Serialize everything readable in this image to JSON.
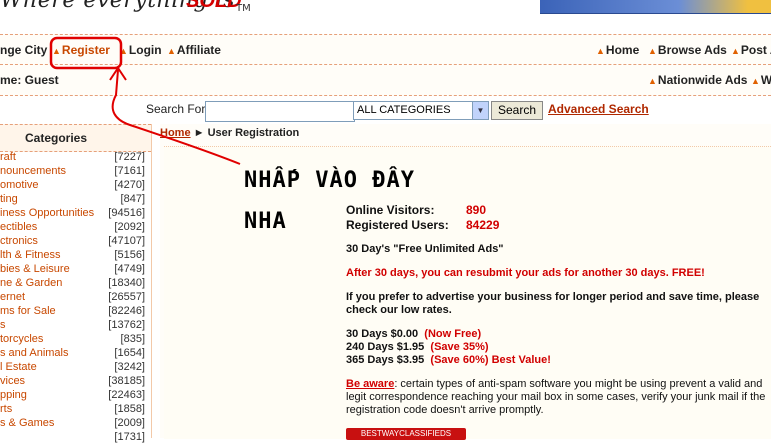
{
  "header": {
    "slogan": "Where everything is",
    "sold": "SOLD",
    "tm": "TM"
  },
  "nav": {
    "row1_left": [
      {
        "label": "nge City"
      },
      {
        "label": "Register"
      },
      {
        "label": "Login"
      },
      {
        "label": "Affiliate"
      }
    ],
    "row1_right": [
      {
        "label": "Home"
      },
      {
        "label": "Browse Ads"
      },
      {
        "label": "Post A"
      }
    ],
    "row2_left": "me: Guest",
    "row2_right": [
      {
        "label": "Nationwide Ads"
      },
      {
        "label": "W"
      }
    ]
  },
  "search": {
    "label": "Search For:",
    "input_value": "",
    "category_selected": "ALL CATEGORIES",
    "button_label": "Search",
    "advanced_label": "Advanced Search"
  },
  "sidebar": {
    "title": "Categories",
    "items": [
      {
        "name": "raft",
        "count": "[7227]"
      },
      {
        "name": "nouncements",
        "count": "[7161]"
      },
      {
        "name": "omotive",
        "count": "[4270]"
      },
      {
        "name": "ting",
        "count": "[847]"
      },
      {
        "name": "iness Opportunities",
        "count": "[94516]"
      },
      {
        "name": "ectibles",
        "count": "[2092]"
      },
      {
        "name": "ctronics",
        "count": "[47107]"
      },
      {
        "name": "lth & Fitness",
        "count": "[5156]"
      },
      {
        "name": "bies & Leisure",
        "count": "[4749]"
      },
      {
        "name": "ne & Garden",
        "count": "[18340]"
      },
      {
        "name": "ernet",
        "count": "[26557]"
      },
      {
        "name": "ms for Sale",
        "count": "[82246]"
      },
      {
        "name": "s",
        "count": "[13762]"
      },
      {
        "name": "torcycles",
        "count": "[835]"
      },
      {
        "name": "s and Animals",
        "count": "[1654]"
      },
      {
        "name": "l Estate",
        "count": "[3242]"
      },
      {
        "name": "vices",
        "count": "[38185]"
      },
      {
        "name": "pping",
        "count": "[22463]"
      },
      {
        "name": "rts",
        "count": "[1858]"
      },
      {
        "name": "s & Games",
        "count": "[2009]"
      },
      {
        "name": "",
        "count": "[1731]"
      }
    ]
  },
  "breadcrumb": {
    "home": "Home",
    "separator": "►",
    "current": "User Registration"
  },
  "annotation": {
    "line1": "NHẤP VÀO ĐÂY",
    "line2": "NHA"
  },
  "stats": {
    "online_label": "Online Visitors:",
    "online_value": "890",
    "registered_label": "Registered Users:",
    "registered_value": "84229"
  },
  "content": {
    "free_ads": "30 Day's \"Free Unlimited Ads\"",
    "resubmit": "After 30 days, you can resubmit your ads for another 30 days. FREE!",
    "advertise_longer": "If you prefer to advertise your business for longer period and save time, please check our low rates.",
    "rates": [
      {
        "term": "30 Days $0.00",
        "note": "(Now Free)"
      },
      {
        "term": "240 Days $1.95",
        "note": "(Save 35%)"
      },
      {
        "term": "365 Days $3.95",
        "note": "(Save 60%) Best Value!"
      }
    ],
    "aware_label": "Be aware",
    "aware_text": ": certain types of anti-spam software you might be using prevent a valid and legit correspondence reaching your mail box in some cases, verify your junk mail if the registration code doesn't arrive promptly.",
    "classifieds_button": "BESTWAYCLASSIFIEDS"
  },
  "colors": {
    "accent_red": "#d10000",
    "link_orange": "#c84800",
    "annotation_red": "#e00000"
  }
}
